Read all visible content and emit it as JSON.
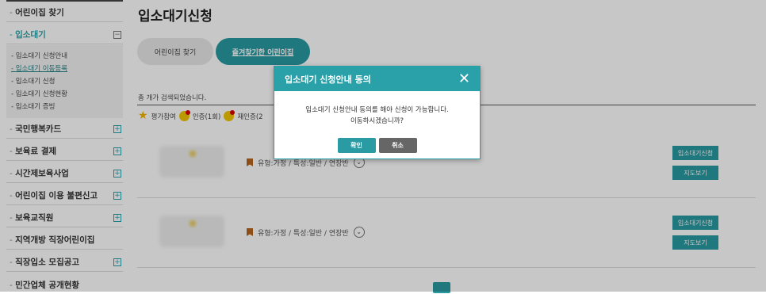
{
  "sidebar": {
    "items": [
      {
        "label": "어린이집 찾기",
        "toggle": ""
      },
      {
        "label": "입소대기",
        "toggle": "−"
      },
      {
        "label": "국민행복카드",
        "toggle": "+"
      },
      {
        "label": "보육료 결제",
        "toggle": "+"
      },
      {
        "label": "시간제보육사업",
        "toggle": "+"
      },
      {
        "label": "어린이집 이용 불편신고",
        "toggle": "+"
      },
      {
        "label": "보육교직원",
        "toggle": "+"
      },
      {
        "label": "지역개방 직장어린이집",
        "toggle": ""
      },
      {
        "label": "직장입소 모집공고",
        "toggle": "+"
      },
      {
        "label": "민간업체 공개현황",
        "toggle": ""
      }
    ],
    "submenu": [
      "입소대기 신청안내",
      "입소대기 이동등록",
      "입소대기 신청",
      "입소대기 신청현황",
      "입소대기 증빙"
    ]
  },
  "main": {
    "title": "입소대기신청",
    "tabs": [
      "어린이집 찾기",
      "즐겨찾기한 어린이집"
    ],
    "result_text": "총 개가 검색되었습니다.",
    "legend": {
      "eval": "평가참여",
      "cert": "인증(1회)",
      "recert": "재인증(2"
    },
    "listings": [
      {
        "info": "유형:가정 / 특성:일반 / 연장반",
        "apply": "입소대기신청",
        "map": "지도보기"
      },
      {
        "info": "유형:가정 / 특성:일반 / 연장반",
        "apply": "입소대기신청",
        "map": "지도보기"
      }
    ]
  },
  "modal": {
    "title": "입소대기 신청안내 동의",
    "close": "✕",
    "line1": "입소대기 신청안내 동의를 해야 신청이 가능합니다.",
    "line2": "이동하시겠습니까?",
    "ok": "확인",
    "cancel": "취소"
  },
  "colors": {
    "accent": "#2aa0a8",
    "button": "#2a9aa3",
    "cancel": "#666666",
    "bookmark": "#b8651b"
  }
}
